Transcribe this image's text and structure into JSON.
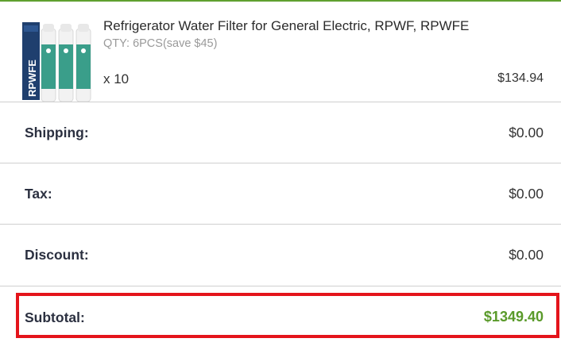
{
  "product": {
    "title": "Refrigerator Water Filter for General Electric, RPWF, RPWFE",
    "qty_option": "QTY: 6PCS(save $45)",
    "multiplier": "x 10",
    "price": "$134.94",
    "image_text": "RPWFE"
  },
  "summary": {
    "shipping_label": "Shipping:",
    "shipping_value": "$0.00",
    "tax_label": "Tax:",
    "tax_value": "$0.00",
    "discount_label": "Discount:",
    "discount_value": "$0.00",
    "subtotal_label": "Subtotal:",
    "subtotal_value": "$1349.40"
  },
  "colors": {
    "accent_green": "#5a9a2a",
    "highlight_red": "#e4141b",
    "box_blue": "#1f3f6e",
    "filter_teal": "#3a9e8a"
  }
}
